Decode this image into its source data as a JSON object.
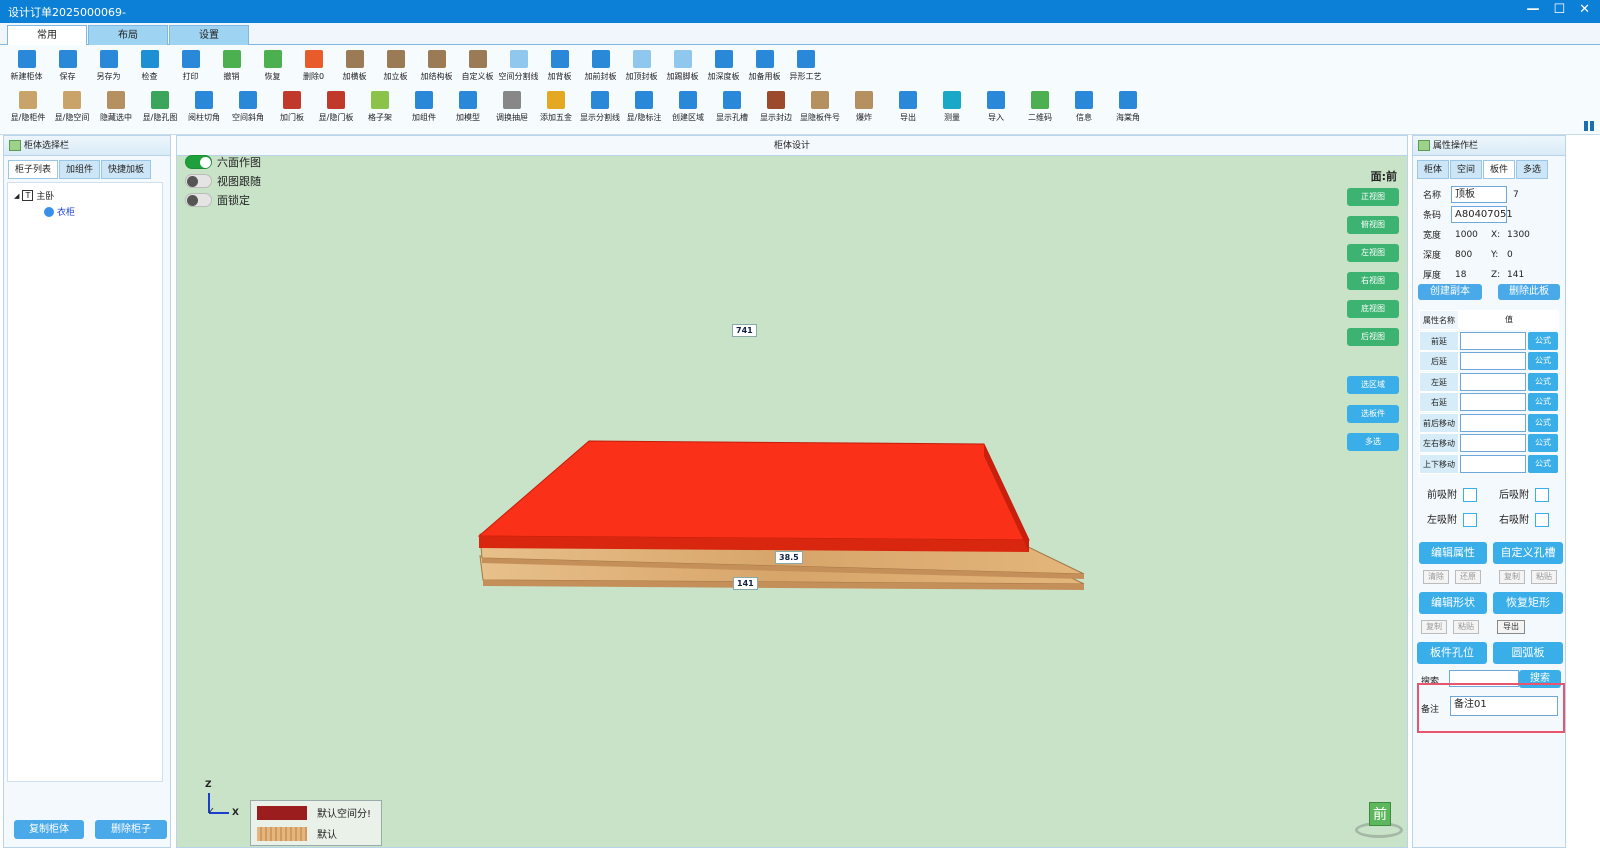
{
  "window": {
    "title": "设计订单2025000069-",
    "buttons": [
      "—",
      "☐",
      "✕"
    ]
  },
  "ribbon": {
    "tabs": [
      "常用",
      "布局",
      "设置"
    ],
    "active": 0
  },
  "toolbar": {
    "row1": [
      {
        "label": "新建柜体",
        "color": "#2a88d8"
      },
      {
        "label": "保存",
        "color": "#2a88d8"
      },
      {
        "label": "另存为",
        "color": "#2a88d8"
      },
      {
        "label": "检查",
        "color": "#1d8fd3"
      },
      {
        "label": "打印",
        "color": "#2a88d8"
      },
      {
        "label": "撤销",
        "color": "#4caf50"
      },
      {
        "label": "恢复",
        "color": "#4caf50"
      },
      {
        "label": "删除0",
        "color": "#e85c2c"
      },
      {
        "label": "加横板",
        "color": "#9a7b55"
      },
      {
        "label": "加立板",
        "color": "#9a7b55"
      },
      {
        "label": "加结构板",
        "color": "#9a7b55"
      },
      {
        "label": "自定义板",
        "color": "#9a7b55"
      },
      {
        "label": "空间分割线",
        "color": "#8fc7ef"
      },
      {
        "label": "加背板",
        "color": "#2a88d8"
      },
      {
        "label": "加前封板",
        "color": "#2a88d8"
      },
      {
        "label": "加顶封板",
        "color": "#8fc7ef"
      },
      {
        "label": "加踢脚板",
        "color": "#8fc7ef"
      },
      {
        "label": "加深度板",
        "color": "#2a88d8"
      },
      {
        "label": "加备用板",
        "color": "#2a88d8"
      },
      {
        "label": "异形工艺",
        "color": "#2a88d8"
      }
    ],
    "row2": [
      {
        "label": "显/隐柜件",
        "color": "#c9a46a"
      },
      {
        "label": "显/隐空间",
        "color": "#c9a46a"
      },
      {
        "label": "隐藏选中",
        "color": "#b59060"
      },
      {
        "label": "显/隐孔图",
        "color": "#3ba55c"
      },
      {
        "label": "阅柱切角",
        "color": "#2a88d8"
      },
      {
        "label": "空间斜角",
        "color": "#2a88d8"
      },
      {
        "label": "加门板",
        "color": "#c0392b"
      },
      {
        "label": "显/隐门板",
        "color": "#c0392b"
      },
      {
        "label": "格子架",
        "color": "#8bc34a"
      },
      {
        "label": "加组件",
        "color": "#2a88d8"
      },
      {
        "label": "加模型",
        "color": "#2a88d8"
      },
      {
        "label": "调换抽屉",
        "color": "#888"
      },
      {
        "label": "添加五金",
        "color": "#e5a823"
      },
      {
        "label": "显示分割线",
        "color": "#2a88d8"
      },
      {
        "label": "显/隐标注",
        "color": "#2a88d8"
      },
      {
        "label": "创建区域",
        "color": "#2a88d8"
      },
      {
        "label": "显示孔槽",
        "color": "#2a88d8"
      },
      {
        "label": "显示封边",
        "color": "#9c4a2c"
      },
      {
        "label": "显隐板件号",
        "color": "#b59060"
      },
      {
        "label": "爆炸",
        "color": "#b59060"
      },
      {
        "label": "导出",
        "color": "#2a88d8"
      },
      {
        "label": "测量",
        "color": "#1aa8c8"
      },
      {
        "label": "导入",
        "color": "#2a88d8"
      },
      {
        "label": "二维码",
        "color": "#4caf50"
      },
      {
        "label": "信息",
        "color": "#2a88d8"
      },
      {
        "label": "海棠角",
        "color": "#2a88d8"
      }
    ]
  },
  "left": {
    "title": "柜体选择栏",
    "tabs": [
      "柜子列表",
      "加组件",
      "快捷加板"
    ],
    "tree_root": "主卧",
    "tree_child": "衣柜",
    "copy_button": "复制柜体",
    "delete_button": "删除柜子"
  },
  "canvas": {
    "title": "柜体设计",
    "toggles": [
      {
        "label": "六面作图",
        "on": true
      },
      {
        "label": "视图跟随",
        "on": false
      },
      {
        "label": "面锁定",
        "on": false
      }
    ],
    "view_label": "面:前",
    "view_buttons": [
      "正视图",
      "俯视图",
      "左视图",
      "右视图",
      "底视图",
      "后视图"
    ],
    "select_buttons": [
      "选区域",
      "选板件",
      "多选"
    ],
    "dims": {
      "top": "741",
      "middle": "38.5",
      "bottom": "141"
    },
    "axes": {
      "z": "Z",
      "x": "X"
    },
    "legend": [
      {
        "label": "默认空间分!",
        "color": "#9b1d1d"
      },
      {
        "label": "默认",
        "color": "#d9a36a"
      }
    ],
    "cube_label": "前"
  },
  "right": {
    "title": "属性操作栏",
    "tabs": [
      "柜体",
      "空间",
      "板件",
      "多选"
    ],
    "active_tab": 2,
    "name_label": "名称",
    "name_value": "顶板",
    "name_extra": "7",
    "code_label": "条码",
    "code_value": "A80407051",
    "width_label": "宽度",
    "width": "1000",
    "x_label": "X:",
    "x": "1300",
    "depth_label": "深度",
    "depth": "800",
    "y_label": "Y:",
    "y": "0",
    "thick_label": "厚度",
    "thick": "18",
    "z_label": "Z:",
    "z": "141",
    "create_copy": "创建副本",
    "delete_board": "删除此板",
    "table_headers": [
      "属性名称",
      "值"
    ],
    "table_rows": [
      "前延",
      "后延",
      "左延",
      "右延",
      "前后移动",
      "左右移动",
      "上下移动"
    ],
    "formula": "公式",
    "attach": [
      "前吸附",
      "后吸附",
      "左吸附",
      "右吸附"
    ],
    "edit_props": "编辑属性",
    "custom_hole": "自定义孔槽",
    "ghost_row1": [
      "清除",
      "还原",
      "复制",
      "粘贴"
    ],
    "edit_shape": "编辑形状",
    "restore_rect": "恢复矩形",
    "ghost_row2": [
      "复制",
      "粘贴",
      "导出"
    ],
    "hole_pos": "板件孔位",
    "arc_board": "圆弧板",
    "search_label": "搜索",
    "search_button": "搜索",
    "note_label": "备注",
    "note_value": "备注01"
  }
}
